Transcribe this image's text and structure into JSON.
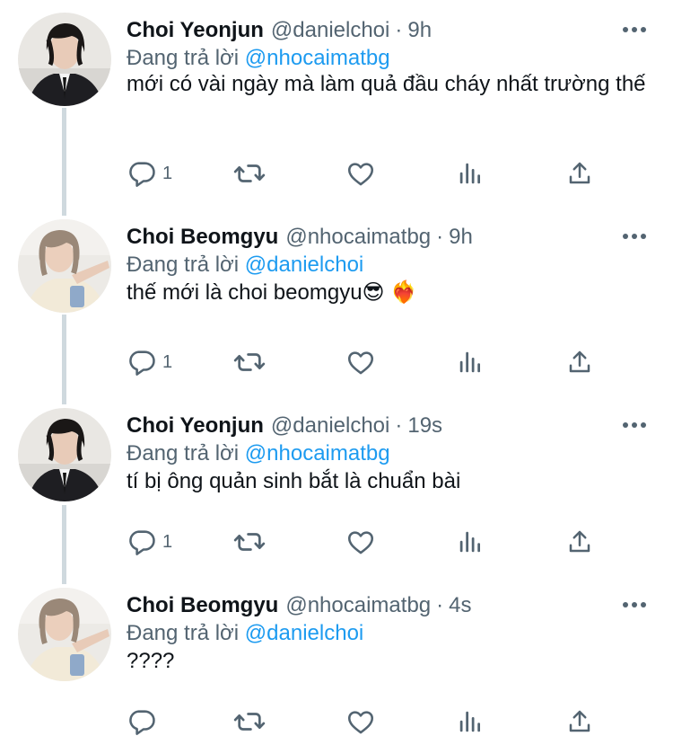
{
  "colors": {
    "text": "#0f1419",
    "secondary": "#536471",
    "accent": "#1d9bf0",
    "thread_line": "#cfd9de"
  },
  "tweets": [
    {
      "name": "Choi Yeonjun",
      "handle": "@danielchoi",
      "dot": "·",
      "time": "9h",
      "replying_prefix": "Đang trả lời",
      "replying_to": "@nhocaimatbg",
      "text": "mới có vài ngày mà làm quả đầu cháy nhất trường thế",
      "reply_count": "1",
      "avatar": "avatar-yeonjun"
    },
    {
      "name": "Choi Beomgyu",
      "handle": "@nhocaimatbg",
      "dot": "·",
      "time": "9h",
      "replying_prefix": "Đang trả lời",
      "replying_to": "@danielchoi",
      "text": "thế mới là choi beomgyu😎 ❤️‍🔥",
      "reply_count": "1",
      "avatar": "avatar-beomgyu"
    },
    {
      "name": "Choi Yeonjun",
      "handle": "@danielchoi",
      "dot": "·",
      "time": "19s",
      "replying_prefix": "Đang trả lời",
      "replying_to": "@nhocaimatbg",
      "text": "tí bị ông quản sinh bắt là chuẩn bài",
      "reply_count": "1",
      "avatar": "avatar-yeonjun"
    },
    {
      "name": "Choi Beomgyu",
      "handle": "@nhocaimatbg",
      "dot": "·",
      "time": "4s",
      "replying_prefix": "Đang trả lời",
      "replying_to": "@danielchoi",
      "text": "????",
      "reply_count": "",
      "avatar": "avatar-beomgyu"
    }
  ],
  "icons": [
    "reply-icon",
    "retweet-icon",
    "like-icon",
    "views-icon",
    "share-icon",
    "more-icon"
  ]
}
